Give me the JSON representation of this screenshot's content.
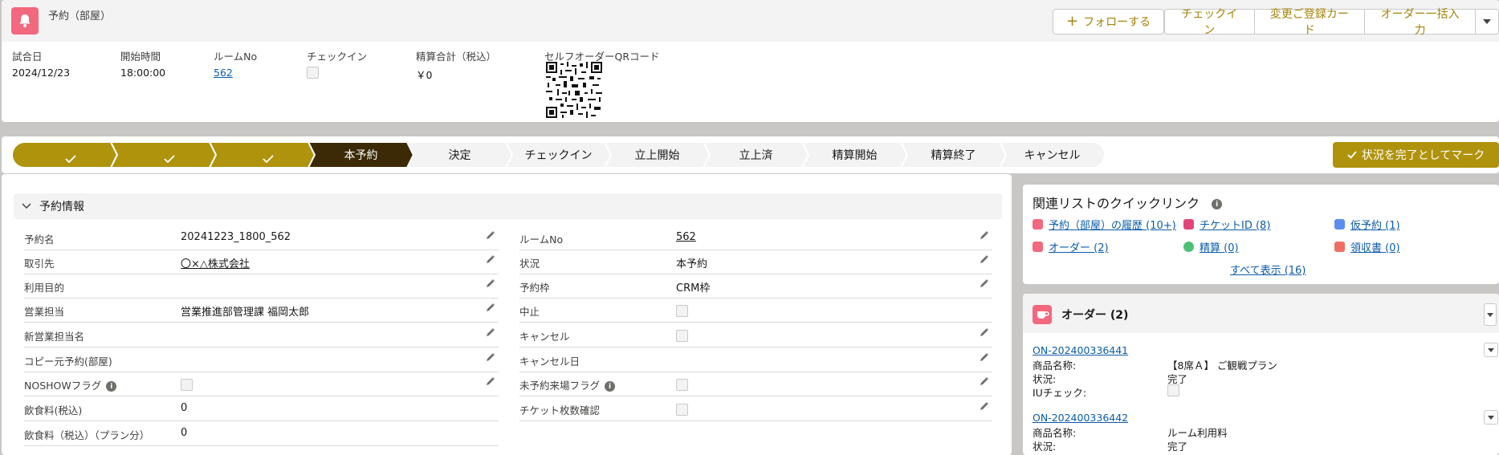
{
  "header": {
    "object_label": "予約（部屋）",
    "actions": {
      "follow": "フォローする",
      "checkin": "チェックイン",
      "change_card": "変更ご登録カード",
      "bulk_order": "オーダー一括入力"
    },
    "fields": {
      "match_date": {
        "label": "試合日",
        "value": "2024/12/23"
      },
      "start_time": {
        "label": "開始時間",
        "value": "18:00:00"
      },
      "room_no": {
        "label": "ルームNo",
        "value": "562"
      },
      "checkin": {
        "label": "チェックイン"
      },
      "total": {
        "label": "精算合計（税込）",
        "value": "￥0"
      },
      "qr": {
        "label": "セルフオーダーQRコード"
      }
    }
  },
  "path": {
    "steps": [
      {
        "label": "",
        "state": "complete"
      },
      {
        "label": "",
        "state": "complete"
      },
      {
        "label": "",
        "state": "complete"
      },
      {
        "label": "本予約",
        "state": "current"
      },
      {
        "label": "決定",
        "state": "incomplete"
      },
      {
        "label": "チェックイン",
        "state": "incomplete"
      },
      {
        "label": "立上開始",
        "state": "incomplete"
      },
      {
        "label": "立上済",
        "state": "incomplete"
      },
      {
        "label": "精算開始",
        "state": "incomplete"
      },
      {
        "label": "精算終了",
        "state": "incomplete"
      },
      {
        "label": "キャンセル",
        "state": "incomplete"
      }
    ],
    "mark_complete": "状況を完了としてマーク"
  },
  "colors": {
    "complete": "#b0930d",
    "current": "#3b2a05",
    "incomplete": "#f3f3f3",
    "accent_text": "#a3830a",
    "link": "#0b5cab"
  },
  "detail": {
    "section_title": "予約情報",
    "left_fields": [
      {
        "label": "予約名",
        "value": "20241223_1800_562"
      },
      {
        "label": "取引先",
        "value": "〇×△株式会社"
      },
      {
        "label": "利用目的",
        "value": ""
      },
      {
        "label": "営業担当",
        "value": "営業推進部管理課 福岡太郎"
      },
      {
        "label": "新営業担当名",
        "value": ""
      },
      {
        "label": "コピー元予約(部屋)",
        "value": ""
      },
      {
        "label": "NOSHOWフラグ",
        "value": ""
      },
      {
        "label": "飲食料(税込)",
        "value": "0"
      },
      {
        "label": "飲食料（税込）（プラン分）",
        "value": "0"
      }
    ],
    "right_fields": [
      {
        "label": "ルームNo",
        "value": "562"
      },
      {
        "label": "状況",
        "value": "本予約"
      },
      {
        "label": "予約枠",
        "value": "CRM枠"
      },
      {
        "label": "中止",
        "value": ""
      },
      {
        "label": "キャンセル",
        "value": ""
      },
      {
        "label": "キャンセル日",
        "value": ""
      },
      {
        "label": "未予約来場フラグ",
        "value": ""
      },
      {
        "label": "チケット枚数確認",
        "value": ""
      }
    ]
  },
  "quick_links": {
    "title": "関連リストのクイックリンク",
    "items": [
      {
        "label": "予約（部屋）の履歴 (10+)",
        "color": "#f2687e"
      },
      {
        "label": "チケットID (8)",
        "color": "#e2457a"
      },
      {
        "label": "仮予約 (1)",
        "color": "#5a8dee"
      },
      {
        "label": "オーダー (2)",
        "color": "#f2687e"
      },
      {
        "label": "精算 (0)",
        "color": "#4bc076"
      },
      {
        "label": "領収書 (0)",
        "color": "#ef6e64"
      }
    ],
    "show_all": "すべて表示 (16)"
  },
  "orders": {
    "title": "オーダー (2)",
    "records": [
      {
        "id": "ON-202400336441",
        "product_label": "商品名称:",
        "product": "【8席Ａ】 ご観戦プラン",
        "status_label": "状況:",
        "status": "完了",
        "iu_label": "IUチェック:"
      },
      {
        "id": "ON-202400336442",
        "product_label": "商品名称:",
        "product": "ルーム利用料",
        "status_label": "状況:",
        "status": "完了"
      }
    ]
  }
}
